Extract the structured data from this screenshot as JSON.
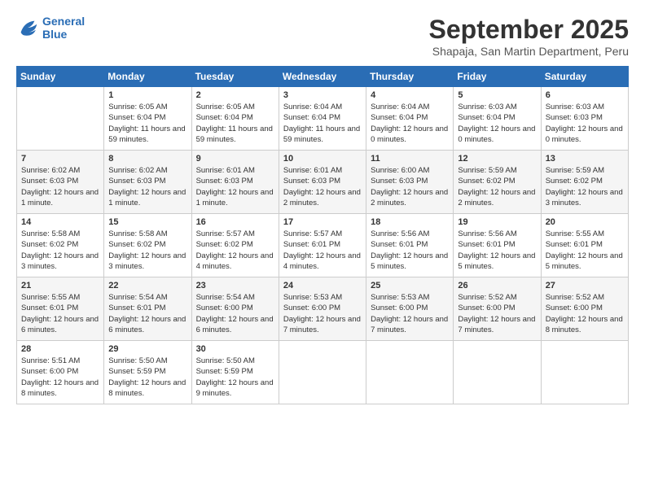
{
  "logo": {
    "line1": "General",
    "line2": "Blue"
  },
  "title": "September 2025",
  "subtitle": "Shapaja, San Martin Department, Peru",
  "days_of_week": [
    "Sunday",
    "Monday",
    "Tuesday",
    "Wednesday",
    "Thursday",
    "Friday",
    "Saturday"
  ],
  "weeks": [
    [
      {
        "day": "",
        "content": ""
      },
      {
        "day": "1",
        "content": "Sunrise: 6:05 AM\nSunset: 6:04 PM\nDaylight: 11 hours and 59 minutes."
      },
      {
        "day": "2",
        "content": "Sunrise: 6:05 AM\nSunset: 6:04 PM\nDaylight: 11 hours and 59 minutes."
      },
      {
        "day": "3",
        "content": "Sunrise: 6:04 AM\nSunset: 6:04 PM\nDaylight: 11 hours and 59 minutes."
      },
      {
        "day": "4",
        "content": "Sunrise: 6:04 AM\nSunset: 6:04 PM\nDaylight: 12 hours and 0 minutes."
      },
      {
        "day": "5",
        "content": "Sunrise: 6:03 AM\nSunset: 6:04 PM\nDaylight: 12 hours and 0 minutes."
      },
      {
        "day": "6",
        "content": "Sunrise: 6:03 AM\nSunset: 6:03 PM\nDaylight: 12 hours and 0 minutes."
      }
    ],
    [
      {
        "day": "7",
        "content": "Sunrise: 6:02 AM\nSunset: 6:03 PM\nDaylight: 12 hours and 1 minute."
      },
      {
        "day": "8",
        "content": "Sunrise: 6:02 AM\nSunset: 6:03 PM\nDaylight: 12 hours and 1 minute."
      },
      {
        "day": "9",
        "content": "Sunrise: 6:01 AM\nSunset: 6:03 PM\nDaylight: 12 hours and 1 minute."
      },
      {
        "day": "10",
        "content": "Sunrise: 6:01 AM\nSunset: 6:03 PM\nDaylight: 12 hours and 2 minutes."
      },
      {
        "day": "11",
        "content": "Sunrise: 6:00 AM\nSunset: 6:03 PM\nDaylight: 12 hours and 2 minutes."
      },
      {
        "day": "12",
        "content": "Sunrise: 5:59 AM\nSunset: 6:02 PM\nDaylight: 12 hours and 2 minutes."
      },
      {
        "day": "13",
        "content": "Sunrise: 5:59 AM\nSunset: 6:02 PM\nDaylight: 12 hours and 3 minutes."
      }
    ],
    [
      {
        "day": "14",
        "content": "Sunrise: 5:58 AM\nSunset: 6:02 PM\nDaylight: 12 hours and 3 minutes."
      },
      {
        "day": "15",
        "content": "Sunrise: 5:58 AM\nSunset: 6:02 PM\nDaylight: 12 hours and 3 minutes."
      },
      {
        "day": "16",
        "content": "Sunrise: 5:57 AM\nSunset: 6:02 PM\nDaylight: 12 hours and 4 minutes."
      },
      {
        "day": "17",
        "content": "Sunrise: 5:57 AM\nSunset: 6:01 PM\nDaylight: 12 hours and 4 minutes."
      },
      {
        "day": "18",
        "content": "Sunrise: 5:56 AM\nSunset: 6:01 PM\nDaylight: 12 hours and 5 minutes."
      },
      {
        "day": "19",
        "content": "Sunrise: 5:56 AM\nSunset: 6:01 PM\nDaylight: 12 hours and 5 minutes."
      },
      {
        "day": "20",
        "content": "Sunrise: 5:55 AM\nSunset: 6:01 PM\nDaylight: 12 hours and 5 minutes."
      }
    ],
    [
      {
        "day": "21",
        "content": "Sunrise: 5:55 AM\nSunset: 6:01 PM\nDaylight: 12 hours and 6 minutes."
      },
      {
        "day": "22",
        "content": "Sunrise: 5:54 AM\nSunset: 6:01 PM\nDaylight: 12 hours and 6 minutes."
      },
      {
        "day": "23",
        "content": "Sunrise: 5:54 AM\nSunset: 6:00 PM\nDaylight: 12 hours and 6 minutes."
      },
      {
        "day": "24",
        "content": "Sunrise: 5:53 AM\nSunset: 6:00 PM\nDaylight: 12 hours and 7 minutes."
      },
      {
        "day": "25",
        "content": "Sunrise: 5:53 AM\nSunset: 6:00 PM\nDaylight: 12 hours and 7 minutes."
      },
      {
        "day": "26",
        "content": "Sunrise: 5:52 AM\nSunset: 6:00 PM\nDaylight: 12 hours and 7 minutes."
      },
      {
        "day": "27",
        "content": "Sunrise: 5:52 AM\nSunset: 6:00 PM\nDaylight: 12 hours and 8 minutes."
      }
    ],
    [
      {
        "day": "28",
        "content": "Sunrise: 5:51 AM\nSunset: 6:00 PM\nDaylight: 12 hours and 8 minutes."
      },
      {
        "day": "29",
        "content": "Sunrise: 5:50 AM\nSunset: 5:59 PM\nDaylight: 12 hours and 8 minutes."
      },
      {
        "day": "30",
        "content": "Sunrise: 5:50 AM\nSunset: 5:59 PM\nDaylight: 12 hours and 9 minutes."
      },
      {
        "day": "",
        "content": ""
      },
      {
        "day": "",
        "content": ""
      },
      {
        "day": "",
        "content": ""
      },
      {
        "day": "",
        "content": ""
      }
    ]
  ]
}
